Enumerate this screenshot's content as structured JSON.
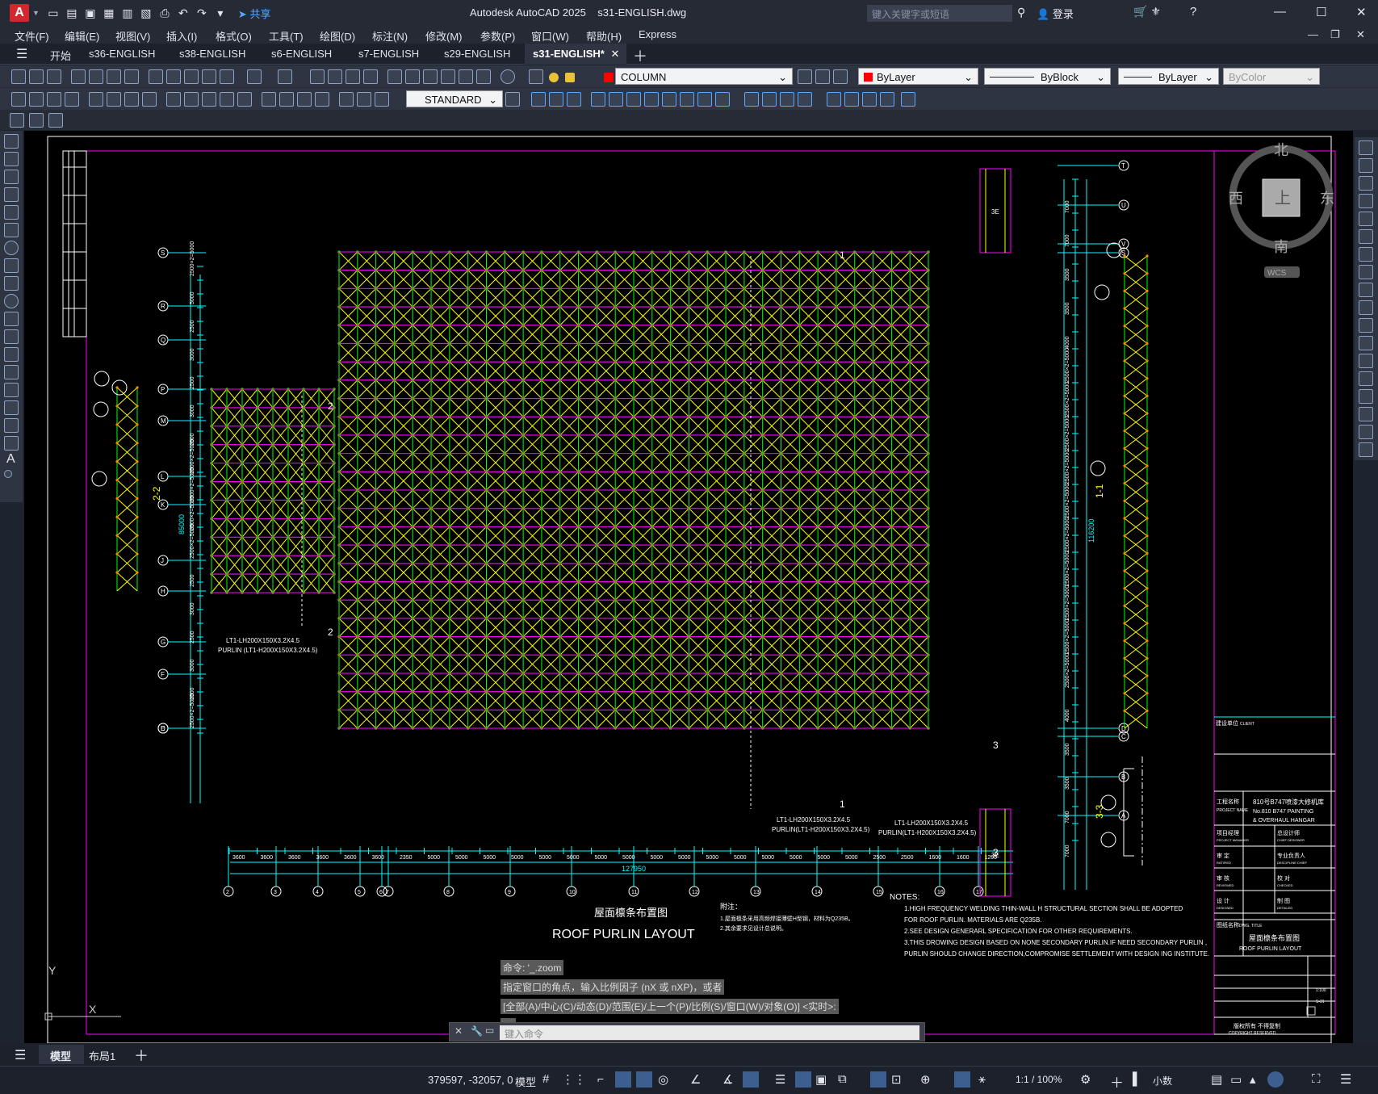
{
  "title_bar": {
    "app_name": "Autodesk AutoCAD 2025",
    "file_name": "s31-ENGLISH.dwg",
    "share": "共享",
    "search_placeholder": "键入关键字或短语",
    "login": "登录",
    "app_letter": "A"
  },
  "menu": [
    "文件(F)",
    "编辑(E)",
    "视图(V)",
    "插入(I)",
    "格式(O)",
    "工具(T)",
    "绘图(D)",
    "标注(N)",
    "修改(M)",
    "参数(P)",
    "窗口(W)",
    "帮助(H)",
    "Express"
  ],
  "file_tabs": [
    "开始",
    "s36-ENGLISH",
    "s38-ENGLISH",
    "s6-ENGLISH",
    "s7-ENGLISH",
    "s29-ENGLISH",
    "s31-ENGLISH*"
  ],
  "toolbar": {
    "layer": "COLUMN",
    "color": "ByLayer",
    "linetype": "ByBlock",
    "lineweight": "ByLayer",
    "plotstyle": "ByColor",
    "dimstyle": "STANDARD"
  },
  "viewcube": {
    "north": "北",
    "south": "南",
    "east": "东",
    "west": "西",
    "top": "上",
    "wcs": "WCS"
  },
  "drawing": {
    "left_axes": [
      "S",
      "R",
      "Q",
      "P",
      "M",
      "L",
      "K",
      "J",
      "H",
      "G",
      "F",
      "E",
      "D"
    ],
    "right_axes": [
      "T",
      "U",
      "V",
      "S",
      "D",
      "C",
      "B",
      "A"
    ],
    "bottom_axes": [
      "2",
      "3",
      "4",
      "5",
      "6",
      "7",
      "8",
      "9",
      "10",
      "11",
      "12",
      "13",
      "14",
      "15",
      "16",
      "17"
    ],
    "bottom_dims": [
      "3600",
      "3600",
      "3600",
      "3600",
      "3600",
      "3600",
      "2350",
      "5000",
      "5000",
      "5000",
      "5000",
      "5000",
      "5000",
      "5000",
      "5000",
      "5000",
      "5000",
      "5000",
      "5000",
      "5000",
      "5000",
      "5000",
      "5000",
      "2500",
      "2500",
      "1600",
      "1600",
      "1200"
    ],
    "total_bottom": "127950",
    "right_dims": [
      "7000",
      "7000",
      "3500",
      "3500",
      "4000",
      "2500×2=5000",
      "2500×2=5000",
      "2500×2=5000",
      "2500×2=5000",
      "2500×2=5000",
      "2500×2=5000",
      "2500×2=5000",
      "2500×2=5000",
      "2500×2=5000",
      "2500×2=5000",
      "4000",
      "3500",
      "3500",
      "7000",
      "7000"
    ],
    "right_total": "116200",
    "left_dims": [
      "2500×2=5000",
      "2500",
      "3000",
      "2500",
      "3000",
      "2500",
      "2500×2=5000",
      "2500×2=5000",
      "2500×2=5000",
      "2500×2=5000",
      "2500",
      "3000",
      "2500",
      "3000",
      "2500",
      "5000",
      "2500×2=5000"
    ],
    "left_total": "85000",
    "section_labels": [
      "1",
      "1",
      "2",
      "2",
      "3",
      "3"
    ],
    "section_titles": [
      "1-1",
      "2-2",
      "3-3"
    ],
    "sf_label": "3E",
    "purlin_a_line1": "LT1-LH200X150X3.2X4.5",
    "purlin_a_line2": "PURLIN (LT1-H200X150X3.2X4.5)",
    "purlin_b_line1": "LT1-LH200X150X3.2X4.5",
    "purlin_b_line2": "PURLIN(LT1-H200X150X3.2X4.5)",
    "purlin_c_line1": "LT1-LH200X150X3.2X4.5",
    "purlin_c_line2": "PURLIN(LT1-H200X150X3.2X4.5)",
    "bottom_title_cn": "屋面檩条布置图",
    "bottom_title_en": "ROOF PURLIN LAYOUT",
    "notes_title": "NOTES:",
    "notes": [
      "1.HIGH  FREQUENCY WELDING THIN-WALL H STRUCTURAL SECTION SHALL BE ADOPTED",
      "   FOR ROOF PURLIN. MATERIALS ARE Q235B.",
      "2.SEE DESIGN GENERARL SPECIFICATION FOR OTHER REQUIREMENTS.",
      "3.THIS DROWING DESIGN BASED ON NONE SECONDARY PURLIN.IF NEED  SECONDARY PURLIN ,",
      "   PURLIN SHOULD CHANGE DIRECTION,COMPROMISE SETTLEMENT WITH  DESIGN ING INSTITUTE."
    ],
    "notes_cn_title": "附注：",
    "notes_cn": [
      "1.屋面檩条采用高频焊接薄壁H型钢，材料为Q235B。",
      "2.其余要求见设计总说明。"
    ],
    "title_block": {
      "client_cn": "建设单位",
      "client_en": "CLIENT",
      "project_cn": "工程名称",
      "project_en": "PROJECT NAME",
      "project_value_cn": "810号B747喷漆大修机库",
      "project_value_en1": "No.810 B747 PAINTING",
      "project_value_en2": "& OVERHAUL HANGAR",
      "pm_cn": "项目经理",
      "pm_en": "PROJECT MANAGER",
      "chief_cn": "总设计师",
      "chief_en": "CHIEF DESIGNER",
      "ratified_cn": "审 定",
      "ratified_en": "RATIFIED",
      "spec_cn": "专业负责人",
      "spec_en": "DESCIPLINE CHIEF",
      "reviewed_cn": "审 核",
      "reviewed_en": "REVIEWED",
      "checked_cn": "校 对",
      "checked_en": "CHECKED",
      "designed_cn": "设 计",
      "designed_en": "DESIGNED",
      "detailed_cn": "制 图",
      "detailed_en": "DETAILED",
      "dwg_title_cn": "图纸名称",
      "dwg_title_en": "DWG. TITLE",
      "dwg_value_cn": "屋面檩条布置图",
      "dwg_value_en": "ROOF PURLIN LAYOUT",
      "copyright_cn": "版权所有 不得复制",
      "copyright_en": "COPYRIGHT RESERVED",
      "scale": "1:100",
      "sheet": "S-31"
    },
    "ucs_y": "Y",
    "ucs_x": "X"
  },
  "command": {
    "history": [
      "命令: '_.zoom",
      "指定窗口的角点，输入比例因子 (nX 或 nXP)，或者",
      "[全部(A)/中心(C)/动态(D)/范围(E)/上一个(P)/比例(S)/窗口(W)/对象(O)] <实时>:",
      "_e"
    ],
    "placeholder": "键入命令"
  },
  "layout_tabs": [
    "模型",
    "布局1"
  ],
  "status": {
    "coords": "379597, -32057, 0",
    "model": "模型",
    "scale": "1:1 / 100%",
    "units": "小数"
  },
  "colors": {
    "yellow": "#ffff00",
    "magenta": "#ff00ff",
    "cyan": "#00ffff",
    "green": "#00ff00",
    "white": "#ffffff",
    "red": "#ff0000",
    "bg": "#000000"
  }
}
